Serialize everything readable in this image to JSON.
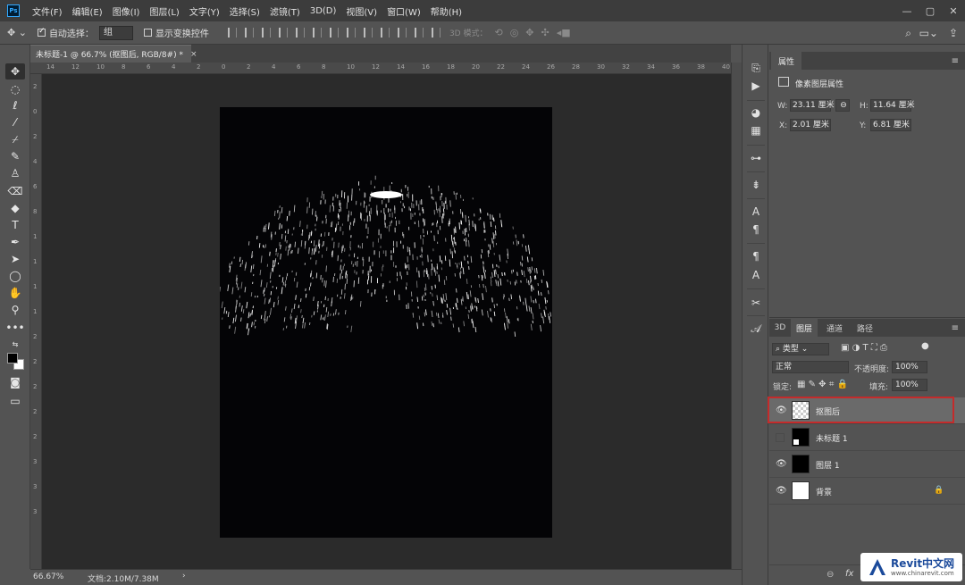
{
  "app": {
    "logo": "Ps"
  },
  "menu": [
    "文件(F)",
    "编辑(E)",
    "图像(I)",
    "图层(L)",
    "文字(Y)",
    "选择(S)",
    "滤镜(T)",
    "3D(D)",
    "视图(V)",
    "窗口(W)",
    "帮助(H)"
  ],
  "window_controls": {
    "minimize": "—",
    "restore": "▢",
    "close": "✕"
  },
  "options_bar": {
    "auto_select_label": "自动选择：",
    "auto_select_checked": true,
    "auto_select_value": "组",
    "show_transform_label": "显示变换控件",
    "show_transform_checked": false,
    "mode_3d_label": "3D 模式："
  },
  "document": {
    "tab_title": "未标题-1 @ 66.7% (抠图后, RGB/8#) *",
    "close_glyph": "×",
    "ruler_h_ticks": [
      "14",
      "12",
      "10",
      "8",
      "6",
      "4",
      "2",
      "0",
      "2",
      "4",
      "6",
      "8",
      "10",
      "12",
      "14",
      "16",
      "18",
      "20",
      "22",
      "24",
      "26",
      "28",
      "30",
      "32",
      "34",
      "36",
      "38",
      "40"
    ],
    "ruler_v_ticks": [
      "2",
      "0",
      "2",
      "4",
      "6",
      "8",
      "1",
      "1",
      "1",
      "1",
      "2",
      "2",
      "2",
      "2",
      "2",
      "3",
      "3",
      "3"
    ],
    "canvas_bg": "#040406"
  },
  "status": {
    "zoom": "66.67%",
    "doc_info": "文档:2.10M/7.38M",
    "arrow": "›"
  },
  "properties": {
    "tab": "属性",
    "header": "像素图层属性",
    "w_label": "W:",
    "w_value": "23.11 厘米",
    "h_label": "H:",
    "h_value": "11.64 厘米",
    "x_label": "X:",
    "x_value": "2.01 厘米",
    "y_label": "Y:",
    "y_value": "6.81 厘米"
  },
  "layers_panel": {
    "tabs": [
      "3D",
      "图层",
      "通道",
      "路径"
    ],
    "filter_label": "类型",
    "blend_mode": "正常",
    "opacity_label": "不透明度:",
    "opacity_value": "100%",
    "lock_label": "锁定:",
    "fill_label": "填充:",
    "fill_value": "100%",
    "layers": [
      {
        "name": "抠图后",
        "visible": true,
        "selected": true
      },
      {
        "name": "未标题 1",
        "visible": false,
        "selected": false
      },
      {
        "name": "图层 1",
        "visible": true,
        "selected": false
      },
      {
        "name": "背景",
        "visible": true,
        "selected": false,
        "locked": true
      }
    ],
    "footer_fx": "fx"
  },
  "watermark": {
    "main": "Revit中文网",
    "sub": "www.chinarevit.com"
  }
}
